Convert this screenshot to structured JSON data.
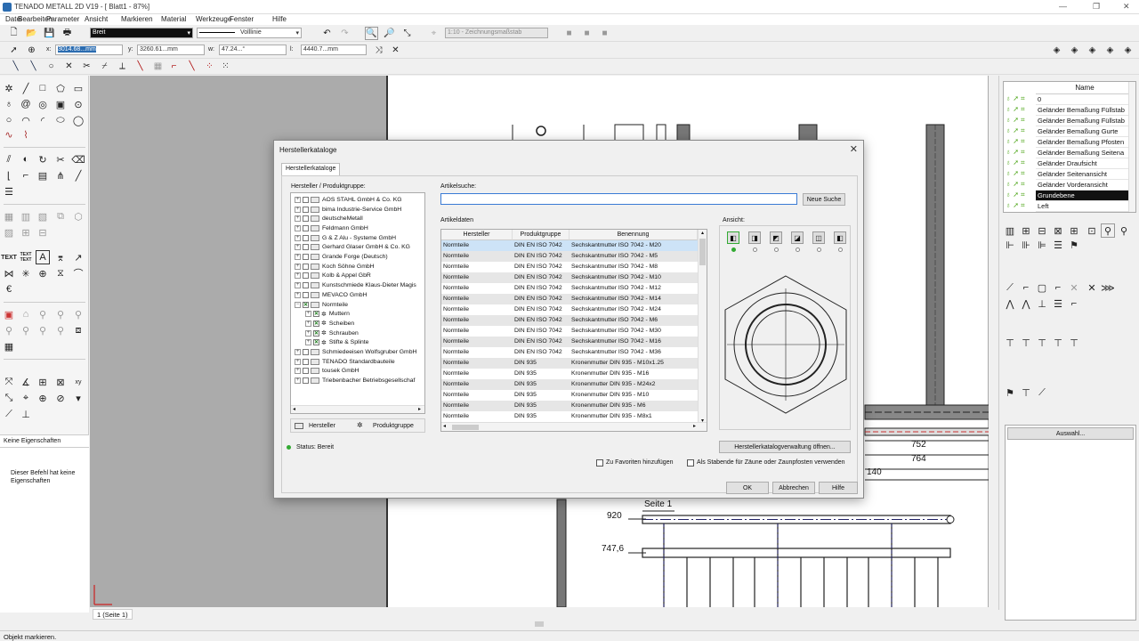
{
  "app": {
    "title": "TENADO METALL 2D V19 - [ Blatt1 - 87%]"
  },
  "menu": [
    "Datei",
    "Bearbeiten",
    "Parameter",
    "Ansicht",
    "Markieren",
    "Material",
    "Werkzeuge",
    "Fenster",
    "Hilfe"
  ],
  "toolbar": {
    "pen_width": "Breit",
    "line_type": "Volllinie",
    "scale": "1:10 - Zeichnungsmaßstab",
    "x_label": "x:",
    "x_value": "3014.68...mm",
    "y_label": "y:",
    "y_value": "3260.61...mm",
    "w_label": "w:",
    "w_value": "47.24...°",
    "l_label": "l:",
    "l_value": "4440.7...mm"
  },
  "left_panel": {
    "text_tool_1": "TEXT",
    "text_tool_2": "TEXT TEXT",
    "props_tab": "Keine Eigenschaften",
    "props_msg": "Dieser Befehl hat keine Eigenschaften"
  },
  "layers": {
    "header": "Name",
    "items": [
      "0",
      "Geländer Bemaßung Füllstab",
      "Geländer Bemaßung Füllstab",
      "Geländer Bemaßung Gurte",
      "Geländer Bemaßung Pfosten",
      "Geländer Bemaßung Seitena",
      "Geländer Draufsicht",
      "Geländer Seitenansicht",
      "Geländer Vorderansicht",
      "Grundebene",
      "Left"
    ],
    "selected_index": 9,
    "auswahl_button": "Auswahl..."
  },
  "drawing": {
    "dim_752": "752",
    "dim_764": "764",
    "dim_140": "140",
    "page_title": "Seite 1",
    "dim_920": "920",
    "dim_7476": "747,6"
  },
  "page_tab": "1 (Seite 1)",
  "status": "Objekt markieren.",
  "dialog": {
    "title": "Herstellerkataloge",
    "tab": "Herstellerkataloge",
    "tree_label": "Hersteller / Produktgruppe:",
    "tree": [
      {
        "label": "AOS STAHL GmbH & Co. KG",
        "level": 0,
        "checked": false,
        "expand": "+"
      },
      {
        "label": "bima Industrie-Service GmbH",
        "level": 0,
        "checked": false,
        "expand": "+"
      },
      {
        "label": "deutscheMetall",
        "level": 0,
        "checked": false,
        "expand": "+"
      },
      {
        "label": "Feldmann GmbH",
        "level": 0,
        "checked": false,
        "expand": "+"
      },
      {
        "label": "G & Z Alu - Systeme GmbH",
        "level": 0,
        "checked": false,
        "expand": "+"
      },
      {
        "label": "Gerhard Glaser GmbH & Co. KG",
        "level": 0,
        "checked": false,
        "expand": "+"
      },
      {
        "label": "Grande Forge (Deutsch)",
        "level": 0,
        "checked": false,
        "expand": "+"
      },
      {
        "label": "Koch Söhne GmbH",
        "level": 0,
        "checked": false,
        "expand": "+"
      },
      {
        "label": "Kolb & Appel GbR",
        "level": 0,
        "checked": false,
        "expand": "+"
      },
      {
        "label": "Kunstschmiede Klaus-Dieter Magis",
        "level": 0,
        "checked": false,
        "expand": "+"
      },
      {
        "label": "MEVACO GmbH",
        "level": 0,
        "checked": false,
        "expand": "+"
      },
      {
        "label": "Normteile",
        "level": 0,
        "checked": true,
        "expand": "−"
      },
      {
        "label": "Muttern",
        "level": 1,
        "checked": true,
        "expand": "+"
      },
      {
        "label": "Scheiben",
        "level": 1,
        "checked": true,
        "expand": "+"
      },
      {
        "label": "Schrauben",
        "level": 1,
        "checked": true,
        "expand": "+"
      },
      {
        "label": "Stifte & Splinte",
        "level": 1,
        "checked": true,
        "expand": "+"
      },
      {
        "label": "Schmiedeeisen Wolfsgruber GmbH",
        "level": 0,
        "checked": false,
        "expand": "+"
      },
      {
        "label": "TENADO Standardbauteile",
        "level": 0,
        "checked": false,
        "expand": "+"
      },
      {
        "label": "tousek GmbH",
        "level": 0,
        "checked": false,
        "expand": "+"
      },
      {
        "label": "Triebenbacher Betriebsgesellschaf",
        "level": 0,
        "checked": false,
        "expand": "+"
      }
    ],
    "legend_manufacturer": "Hersteller",
    "legend_group": "Produktgruppe",
    "status": "Status: Bereit",
    "search_label": "Artikelsuche:",
    "search_value": "",
    "new_search_button": "Neue Suche",
    "data_label": "Artikeldaten",
    "columns": [
      "Hersteller",
      "Produktgruppe",
      "Benennung"
    ],
    "rows": [
      [
        "Normteile",
        "DIN EN ISO 7042",
        "Sechskantmutter ISO 7042 - M20"
      ],
      [
        "Normteile",
        "DIN EN ISO 7042",
        "Sechskantmutter ISO 7042 - M5"
      ],
      [
        "Normteile",
        "DIN EN ISO 7042",
        "Sechskantmutter ISO 7042 - M8"
      ],
      [
        "Normteile",
        "DIN EN ISO 7042",
        "Sechskantmutter ISO 7042 - M10"
      ],
      [
        "Normteile",
        "DIN EN ISO 7042",
        "Sechskantmutter ISO 7042 - M12"
      ],
      [
        "Normteile",
        "DIN EN ISO 7042",
        "Sechskantmutter ISO 7042 - M14"
      ],
      [
        "Normteile",
        "DIN EN ISO 7042",
        "Sechskantmutter ISO 7042 - M24"
      ],
      [
        "Normteile",
        "DIN EN ISO 7042",
        "Sechskantmutter ISO 7042 - M6"
      ],
      [
        "Normteile",
        "DIN EN ISO 7042",
        "Sechskantmutter ISO 7042 - M30"
      ],
      [
        "Normteile",
        "DIN EN ISO 7042",
        "Sechskantmutter ISO 7042 - M16"
      ],
      [
        "Normteile",
        "DIN EN ISO 7042",
        "Sechskantmutter ISO 7042 - M36"
      ],
      [
        "Normteile",
        "DIN 935",
        "Kronenmutter DIN 935 - M10x1.25"
      ],
      [
        "Normteile",
        "DIN 935",
        "Kronenmutter DIN 935 - M16"
      ],
      [
        "Normteile",
        "DIN 935",
        "Kronenmutter DIN 935 - M24x2"
      ],
      [
        "Normteile",
        "DIN 935",
        "Kronenmutter DIN 935 - M10"
      ],
      [
        "Normteile",
        "DIN 935",
        "Kronenmutter DIN 935 - M6"
      ],
      [
        "Normteile",
        "DIN 935",
        "Kronenmutter DIN 935 - M8x1"
      ]
    ],
    "selected_row": 0,
    "view_label": "Ansicht:",
    "catalog_button": "Herstellerkatalogverwaltung öffnen...",
    "fav_label": "Zu Favoriten hinzufügen",
    "stab_label": "Als Stabende für Zäune oder Zaunpfosten verwenden",
    "ok": "OK",
    "cancel": "Abbrechen",
    "help": "Hilfe"
  }
}
